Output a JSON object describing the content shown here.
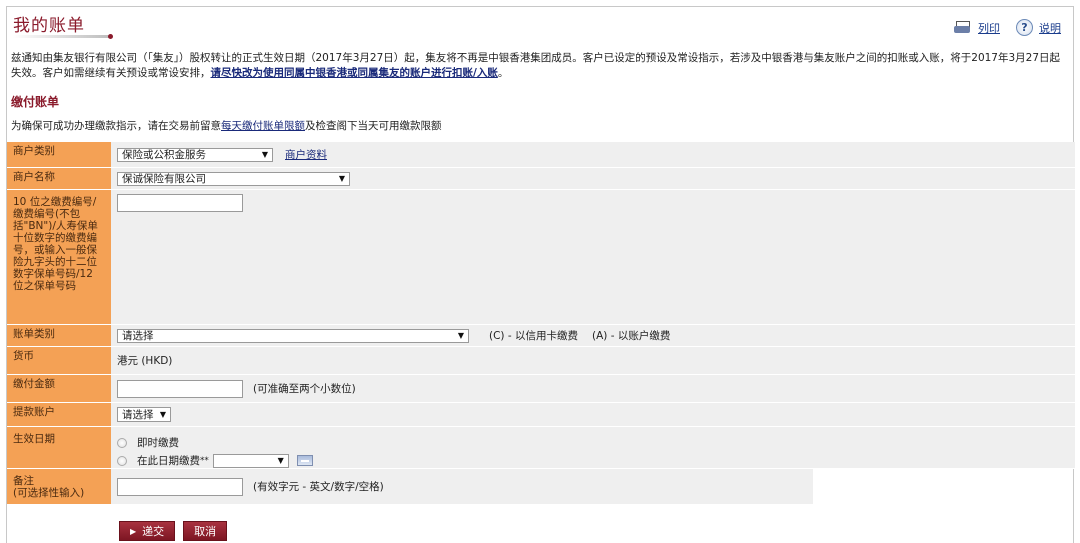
{
  "header": {
    "title": "我的账单",
    "print_label": "列印",
    "help_label": "说明"
  },
  "notice": {
    "text": "兹通知由集友银行有限公司（「集友」）股权转让的正式生效日期（2017年3月27日）起，集友将不再是中银香港集团成员。客户已设定的预设及常设指示，若涉及中银香港与集友账户之间的扣账或入账，将于2017年3月27日起失效。客户如需继续有关预设或常设安排，",
    "link_text": "请尽快改为使用同属中银香港或同属集友的账户进行扣账/入账",
    "end": "。"
  },
  "section": {
    "title": "缴付账单",
    "intro_before": "为确保可成功办理缴款指示，请在交易前留意",
    "intro_link": "每天缴付账单限额",
    "intro_after": "及检查阁下当天可用缴款限额"
  },
  "form": {
    "merchant_type": {
      "label": "商户类别",
      "value": "保险或公积金服务",
      "link": "商户资料"
    },
    "merchant_name": {
      "label": "商户名称",
      "value": "保诚保险有限公司"
    },
    "bill_number": {
      "label": "10 位之缴费编号/ 缴费编号(不包括\"BN\")/人寿保单十位数字的缴费编号，或输入一般保险九字头的十二位数字保单号码/12 位之保单号码",
      "value": ""
    },
    "bill_type": {
      "label": "账单类别",
      "value": "请选择",
      "hint_c": "(C) - 以信用卡缴费",
      "hint_a": "(A) - 以账户缴费"
    },
    "currency": {
      "label": "货币",
      "value": "港元 (HKD)"
    },
    "amount": {
      "label": "缴付金额",
      "value": "",
      "hint": "(可准确至两个小数位)"
    },
    "debit_account": {
      "label": "提款账户",
      "value": "请选择"
    },
    "effective_date": {
      "label": "生效日期",
      "option_now": "即时缴费",
      "option_date": "在此日期缴费",
      "marker": "**",
      "date_value": ""
    },
    "remark": {
      "label": "备注",
      "label_sub": "(可选择性输入)",
      "value": "",
      "hint": "(有效字元 - 英文/数字/空格)"
    }
  },
  "actions": {
    "submit_label": "递交",
    "cancel_label": "取消"
  }
}
